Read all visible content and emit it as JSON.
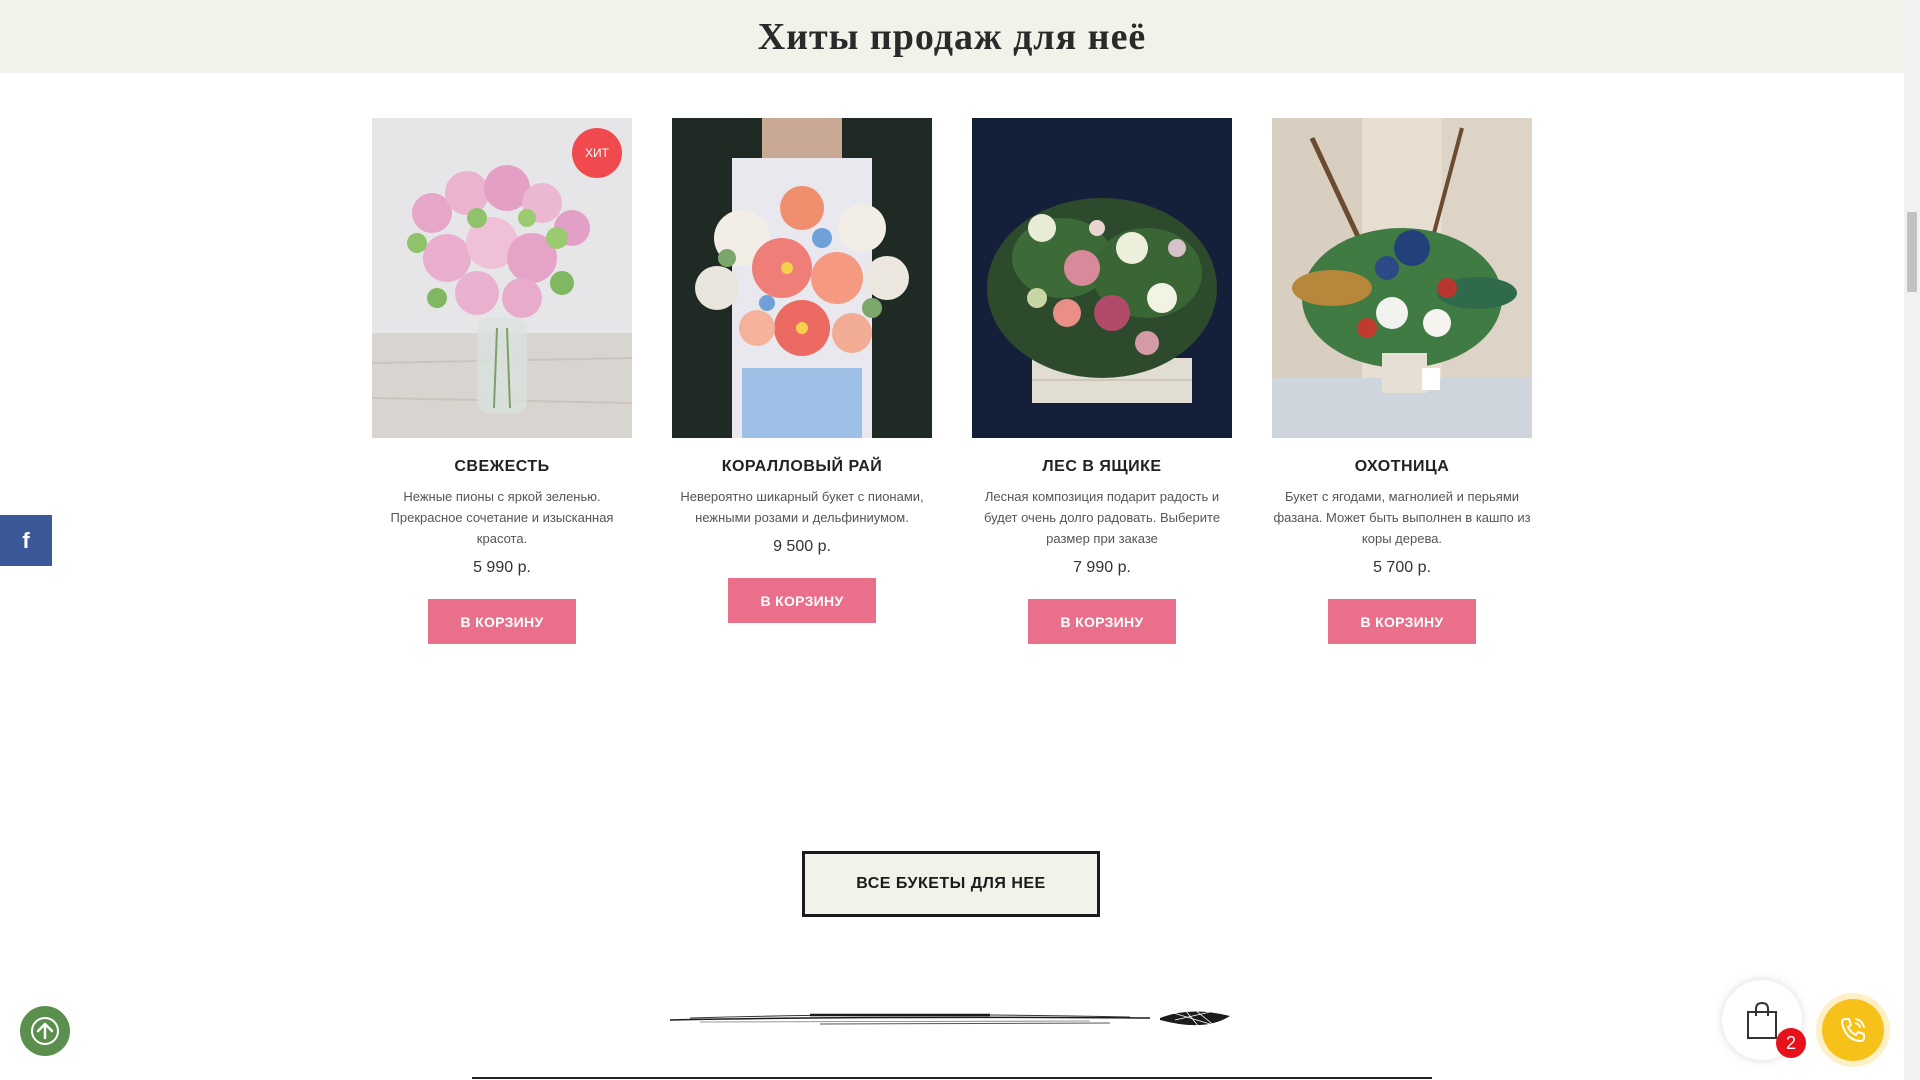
{
  "section": {
    "title": "Хиты продаж для неё"
  },
  "products": [
    {
      "name": "СВЕЖЕСТЬ",
      "description": "Нежные пионы с яркой зеленью. Прекрасное сочетание и изысканная красота.",
      "price": "5 990 р.",
      "badge": "ХИТ",
      "button_label": "В КОРЗИНУ"
    },
    {
      "name": "КОРАЛЛОВЫЙ РАЙ",
      "description": "Невероятно шикарный букет с пионами, нежными розами и дельфиниумом.",
      "price": "9 500 р.",
      "button_label": "В КОРЗИНУ"
    },
    {
      "name": "ЛЕС В ЯЩИКЕ",
      "description": "Лесная композиция подарит радость и будет очень долго радовать. Выберите размер при заказе",
      "price": "7 990 р.",
      "button_label": "В КОРЗИНУ"
    },
    {
      "name": "ОХОТНИЦА",
      "description": "Букет с ягодами, магнолией и перьями фазана. Может быть выполнен в кашпо из коры дерева.",
      "price": "5 700 р.",
      "button_label": "В КОРЗИНУ"
    }
  ],
  "all_bouquets_label": "ВСЕ БУКЕТЫ ДЛЯ НЕЕ",
  "cart": {
    "count": "2"
  },
  "social": {
    "facebook_glyph": "f"
  },
  "colors": {
    "header_bg": "#eff3ea",
    "cart_button": "#ea6f8a",
    "badge": "#f04a4f",
    "facebook": "#3b5998",
    "scroll_top": "#5b8f4e",
    "callback": "#f6c21a",
    "cart_count": "#e8101a"
  },
  "icons": {
    "facebook": "facebook-icon",
    "scroll_top": "arrow-up-icon",
    "cart": "shopping-bag-icon",
    "callback": "phone-icon"
  }
}
